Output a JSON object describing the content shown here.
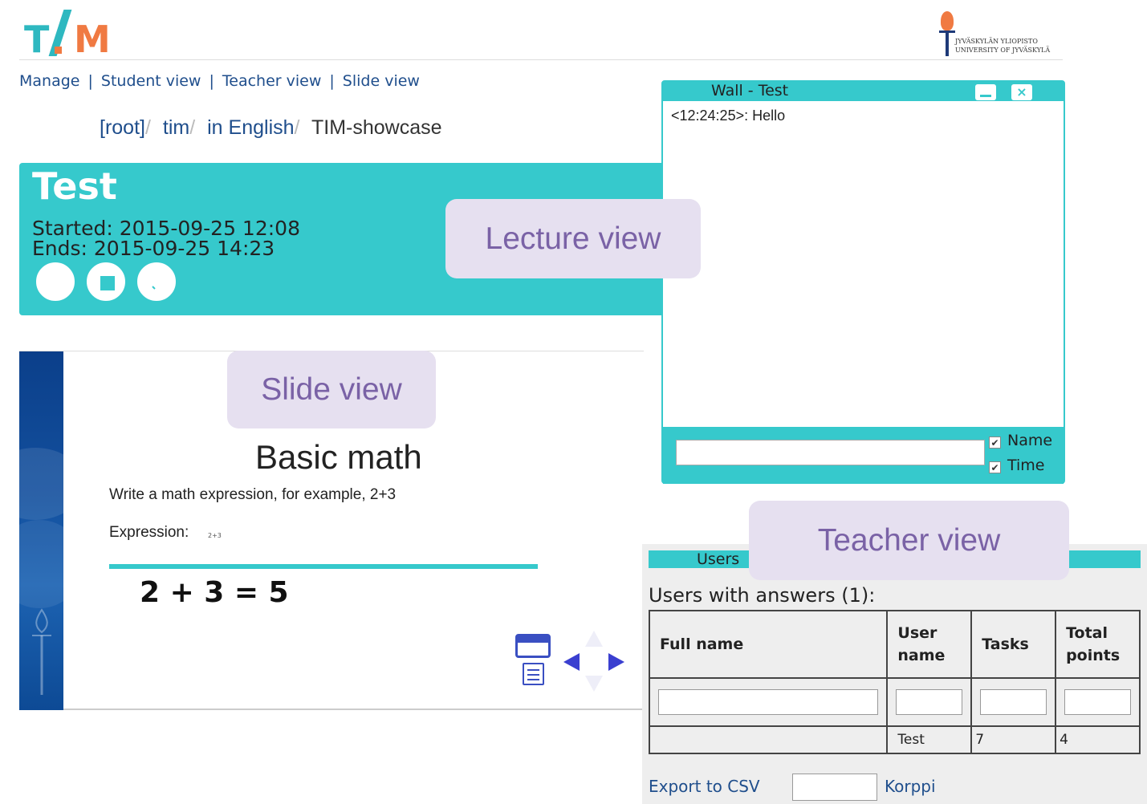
{
  "header": {
    "logo": "TIM",
    "university_logo_lines": [
      "JYVÄSKYLÄN YLIOPISTO",
      "UNIVERSITY OF JYVÄSKYLÄ"
    ]
  },
  "nav": {
    "items": [
      "Manage",
      "Student view",
      "Teacher view",
      "Slide view"
    ],
    "separator": "|"
  },
  "breadcrumb": {
    "items": [
      "[root]",
      "tim",
      "in English"
    ],
    "separator": "/",
    "current": "TIM-showcase"
  },
  "lecture": {
    "title": "Test",
    "started": "Started: 2015-09-25 12:08",
    "ends": "Ends: 2015-09-25 14:23",
    "buttons": [
      "leave-icon",
      "stop-icon",
      "edit-icon"
    ]
  },
  "callouts": {
    "lecture": "Lecture view",
    "slide": "Slide view",
    "teacher": "Teacher view"
  },
  "slide": {
    "heading": "Basic math",
    "instructions": "Write a math expression, for example, 2+3",
    "expression_label": "Expression:",
    "expression_value": "2+3",
    "result": "2 + 3 = 5"
  },
  "wall": {
    "title": "Wall - Test",
    "close_label": "×",
    "messages": [
      "<12:24:25>: Hello"
    ],
    "input_value": "",
    "check_name": "Name",
    "check_time": "Time",
    "check_mark": "✔"
  },
  "teacher": {
    "tab_label": "Users",
    "heading": "Users with answers (1):",
    "columns": [
      "Full name",
      "User name",
      "Tasks",
      "Total points"
    ],
    "rows": [
      {
        "full_name": "",
        "user_name": "Test",
        "tasks": "7",
        "total_points": "4"
      }
    ],
    "export_label": "Export to CSV",
    "korppi_label": "Korppi"
  },
  "colors": {
    "accent": "#36c9cc",
    "link": "#1f4e8c",
    "callout_bg": "#e6e0f0",
    "callout_text": "#7a62a6",
    "logo_orange": "#f07a42"
  }
}
